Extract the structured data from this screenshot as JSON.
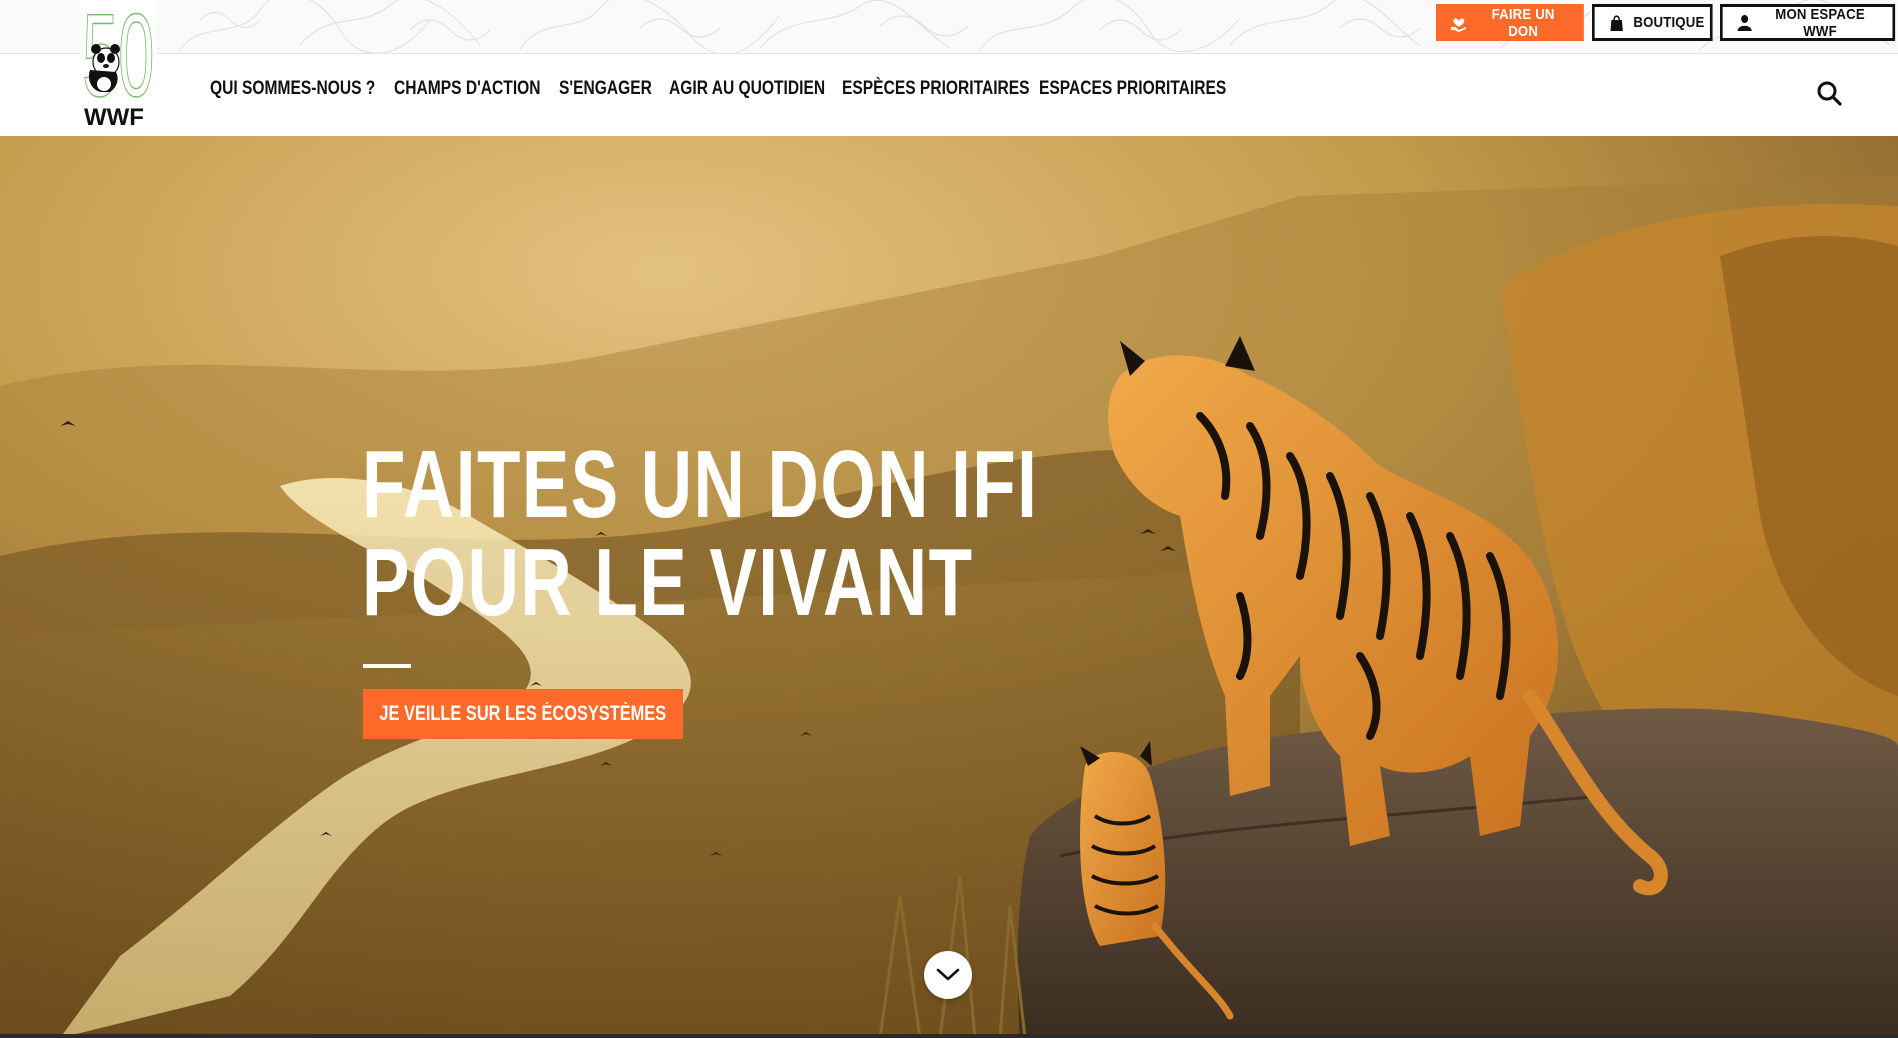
{
  "brand": {
    "logo_text": "WWF",
    "logo_icon": "panda-icon",
    "anniversary_number": "50"
  },
  "utility": {
    "donate_label": "FAIRE UN DON",
    "donate_icon": "heart-hand-icon",
    "shop_label": "BOUTIQUE",
    "shop_icon": "bag-icon",
    "account_label": "MON ESPACE WWF",
    "account_icon": "user-icon"
  },
  "nav": {
    "items": [
      {
        "label": "QUI SOMMES-NOUS ?"
      },
      {
        "label": "CHAMPS D'ACTION"
      },
      {
        "label": "S'ENGAGER"
      },
      {
        "label": "AGIR AU QUOTIDIEN"
      },
      {
        "label": "ESPÈCES PRIORITAIRES"
      },
      {
        "label": "ESPACES PRIORITAIRES"
      }
    ],
    "search_icon": "search-icon"
  },
  "hero": {
    "title_line1": "FAITES UN DON IFI",
    "title_line2": "POUR LE VIVANT",
    "cta_label": "JE VEILLE SUR LES ÉCOSYSTÈMES",
    "scroll_icon": "chevron-down-icon"
  },
  "colors": {
    "accent": "#ff6a2b",
    "text": "#111111",
    "hero_text": "#ffffff"
  }
}
